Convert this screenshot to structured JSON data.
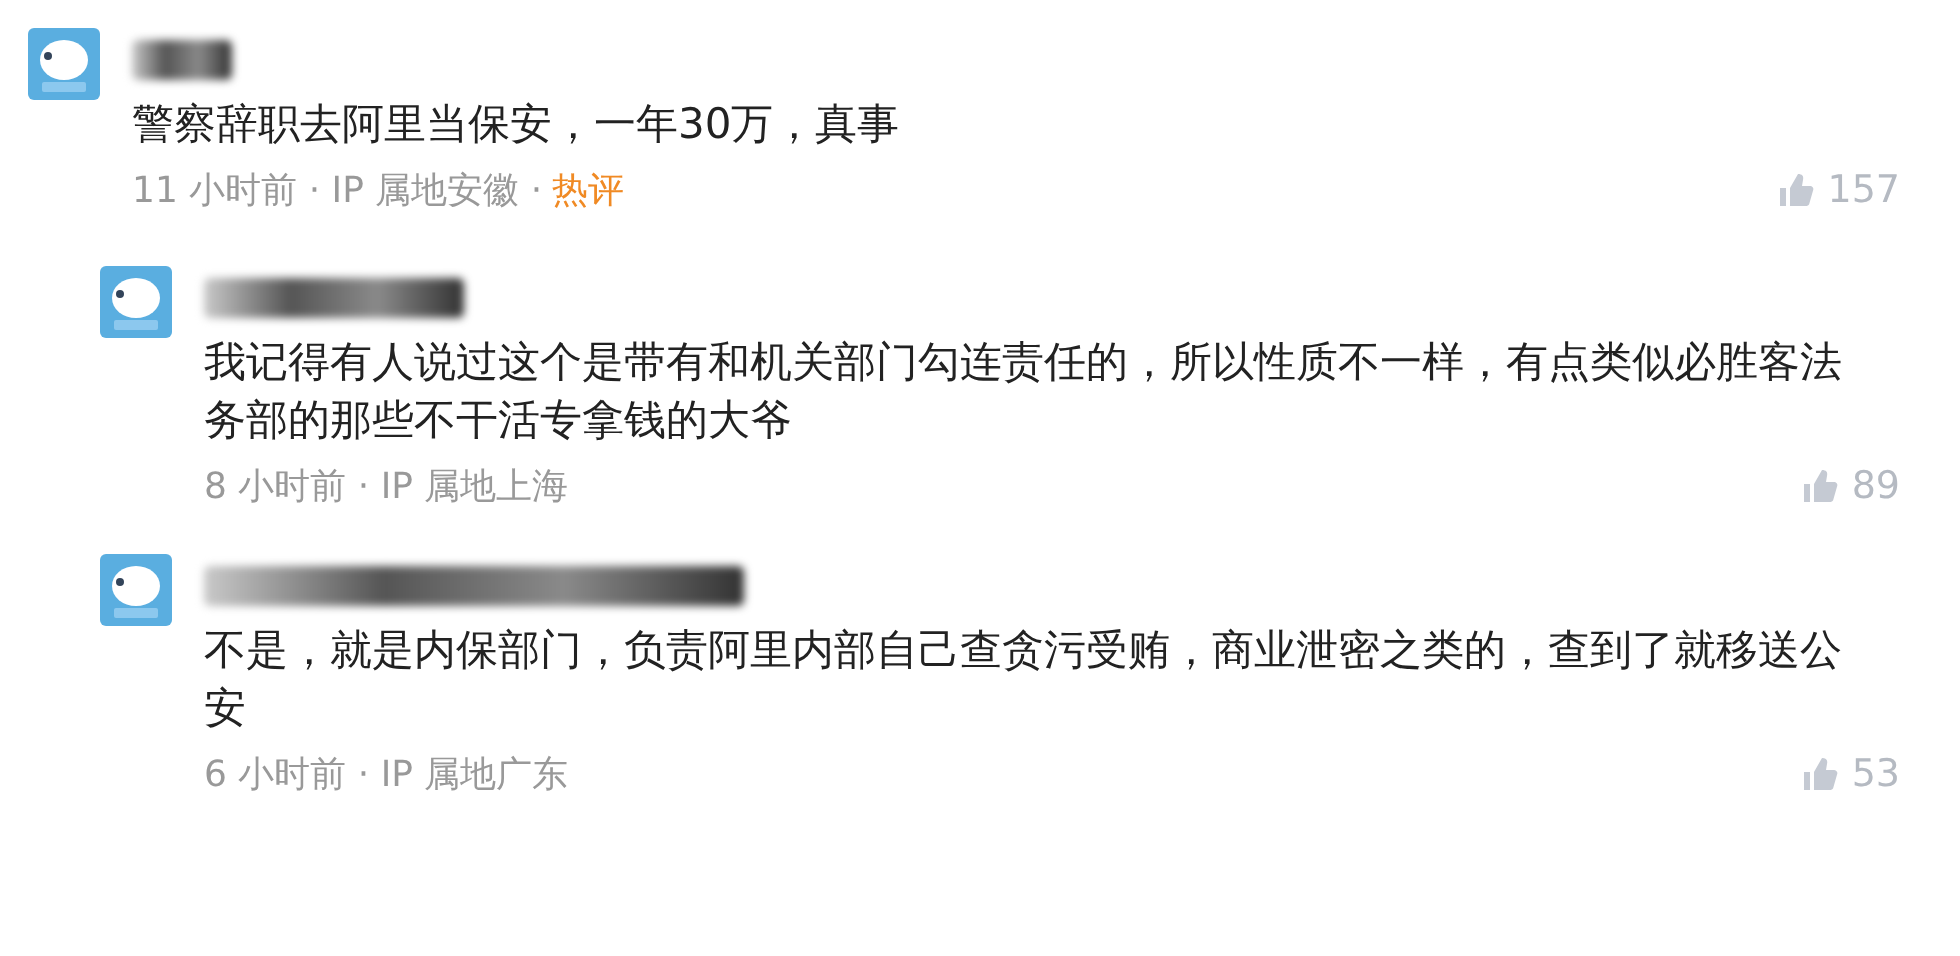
{
  "comments": [
    {
      "text": "警察辞职去阿里当保安，一年30万，真事",
      "meta": "11 小时前 · IP 属地安徽 ·",
      "badge": "热评",
      "likes": "157",
      "children": [
        {
          "text": "我记得有人说过这个是带有和机关部门勾连责任的，所以性质不一样，有点类似必胜客法务部的那些不干活专拿钱的大爷",
          "meta": "8 小时前 · IP 属地上海",
          "likes": "89"
        },
        {
          "text": "不是，就是内保部门，负责阿里内部自己查贪污受贿，商业泄密之类的，查到了就移送公安",
          "meta": "6 小时前 · IP 属地广东",
          "likes": "53"
        }
      ]
    }
  ]
}
